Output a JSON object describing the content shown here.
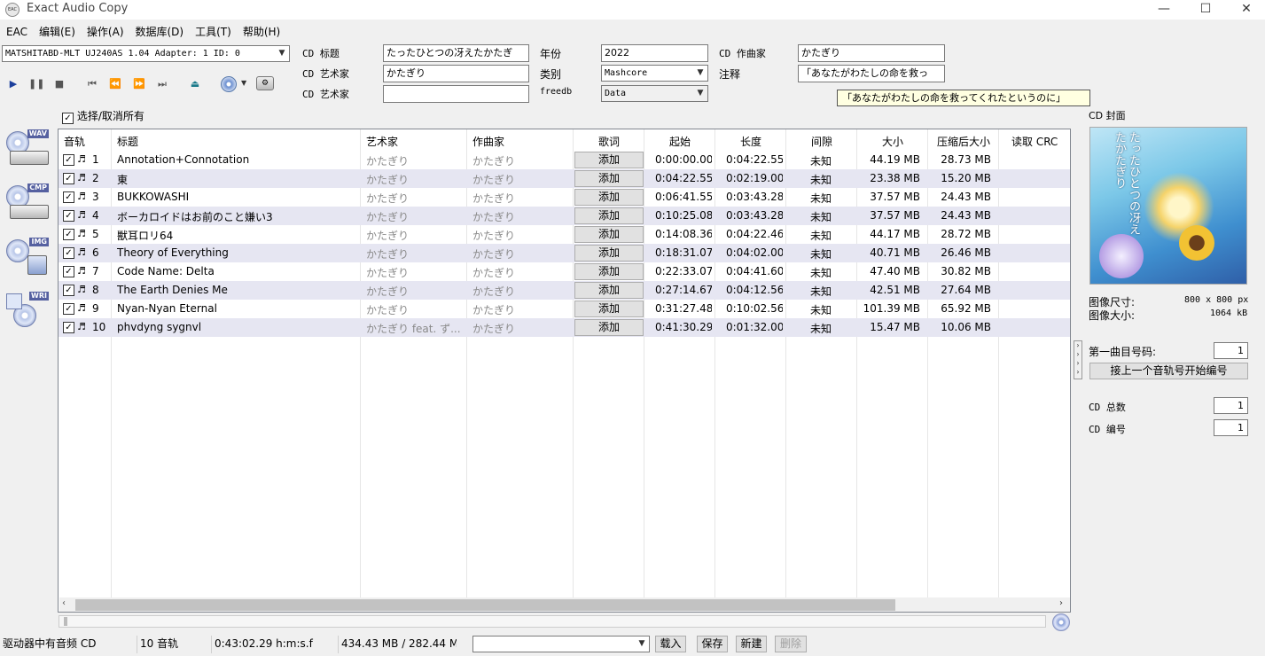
{
  "window": {
    "title": "Exact Audio Copy",
    "icon_text": "EAC",
    "minimize_glyph": "—",
    "maximize_glyph": "☐",
    "close_glyph": "✕"
  },
  "menu": [
    "EAC",
    "编辑(E)",
    "操作(A)",
    "数据库(D)",
    "工具(T)",
    "帮助(H)"
  ],
  "drive": {
    "selected": "MATSHITABD-MLT UJ240AS 1.04   Adapter: 1  ID: 0"
  },
  "metadata": {
    "cd_title_label": "CD 标题",
    "cd_title": "たったひとつの冴えたかたぎ",
    "cd_artist_label": "CD 艺术家",
    "cd_artist": "かたぎり",
    "cd_artist2_label": "CD 艺术家",
    "cd_artist2": "",
    "year_label": "年份",
    "year": "2022",
    "genre_label": "类别",
    "genre": "Mashcore",
    "freedb_label": "freedb",
    "freedb": "Data",
    "composer_label": "CD 作曲家",
    "composer": "かたぎり",
    "comment_label": "注释",
    "comment": "「あなたがわたしの命を救っ",
    "tooltip": "「あなたがわたしの命を救ってくれたというのに」"
  },
  "select_all_label": "选择/取消所有",
  "side_icons": [
    {
      "name": "wav-icon",
      "tag": "WAV"
    },
    {
      "name": "cmp-icon",
      "tag": "CMP"
    },
    {
      "name": "img-icon",
      "tag": "IMG"
    },
    {
      "name": "wri-icon",
      "tag": "WRI"
    }
  ],
  "table": {
    "headers": {
      "track": "音轨",
      "title": "标题",
      "artist": "艺术家",
      "composer": "作曲家",
      "lyrics": "歌词",
      "start": "起始",
      "length": "长度",
      "gap": "间隙",
      "size": "大小",
      "compressed": "压缩后大小",
      "crc": "读取 CRC"
    },
    "rows": [
      {
        "num": "1",
        "title": "Annotation+Connotation",
        "artist": "かたぎり",
        "composer": "かたぎり",
        "lyrics": "添加",
        "start": "0:00:00.00",
        "length": "0:04:22.55",
        "gap": "未知",
        "size": "44.19 MB",
        "compressed": "28.73 MB",
        "crc": ""
      },
      {
        "num": "2",
        "title": "東",
        "artist": "かたぎり",
        "composer": "かたぎり",
        "lyrics": "添加",
        "start": "0:04:22.55",
        "length": "0:02:19.00",
        "gap": "未知",
        "size": "23.38 MB",
        "compressed": "15.20 MB",
        "crc": ""
      },
      {
        "num": "3",
        "title": "BUKKOWASHI",
        "artist": "かたぎり",
        "composer": "かたぎり",
        "lyrics": "添加",
        "start": "0:06:41.55",
        "length": "0:03:43.28",
        "gap": "未知",
        "size": "37.57 MB",
        "compressed": "24.43 MB",
        "crc": ""
      },
      {
        "num": "4",
        "title": "ボーカロイドはお前のこと嫌い3",
        "artist": "かたぎり",
        "composer": "かたぎり",
        "lyrics": "添加",
        "start": "0:10:25.08",
        "length": "0:03:43.28",
        "gap": "未知",
        "size": "37.57 MB",
        "compressed": "24.43 MB",
        "crc": ""
      },
      {
        "num": "5",
        "title": "獣耳ロリ64",
        "artist": "かたぎり",
        "composer": "かたぎり",
        "lyrics": "添加",
        "start": "0:14:08.36",
        "length": "0:04:22.46",
        "gap": "未知",
        "size": "44.17 MB",
        "compressed": "28.72 MB",
        "crc": ""
      },
      {
        "num": "6",
        "title": "Theory of Everything",
        "artist": "かたぎり",
        "composer": "かたぎり",
        "lyrics": "添加",
        "start": "0:18:31.07",
        "length": "0:04:02.00",
        "gap": "未知",
        "size": "40.71 MB",
        "compressed": "26.46 MB",
        "crc": ""
      },
      {
        "num": "7",
        "title": "Code Name: Delta",
        "artist": "かたぎり",
        "composer": "かたぎり",
        "lyrics": "添加",
        "start": "0:22:33.07",
        "length": "0:04:41.60",
        "gap": "未知",
        "size": "47.40 MB",
        "compressed": "30.82 MB",
        "crc": ""
      },
      {
        "num": "8",
        "title": "The Earth Denies Me",
        "artist": "かたぎり",
        "composer": "かたぎり",
        "lyrics": "添加",
        "start": "0:27:14.67",
        "length": "0:04:12.56",
        "gap": "未知",
        "size": "42.51 MB",
        "compressed": "27.64 MB",
        "crc": ""
      },
      {
        "num": "9",
        "title": "Nyan-Nyan Eternal",
        "artist": "かたぎり",
        "composer": "かたぎり",
        "lyrics": "添加",
        "start": "0:31:27.48",
        "length": "0:10:02.56",
        "gap": "未知",
        "size": "101.39 MB",
        "compressed": "65.92 MB",
        "crc": ""
      },
      {
        "num": "10",
        "title": "phvdyng sygnvl",
        "artist": "かたぎり feat. ず...",
        "composer": "かたぎり",
        "lyrics": "添加",
        "start": "0:41:30.29",
        "length": "0:01:32.00",
        "gap": "未知",
        "size": "15.47 MB",
        "compressed": "10.06 MB",
        "crc": ""
      }
    ]
  },
  "cover": {
    "label": "CD 封面",
    "art_text": "たったひとつの冴えたかたぎり",
    "dims_label": "图像尺寸:",
    "dims_value": "800 x 800 px",
    "size_label": "图像大小:",
    "size_value": "1064 kB"
  },
  "numbering": {
    "first_track_label": "第一曲目号码:",
    "first_track_value": "1",
    "continue_button": "接上一个音轨号开始编号",
    "total_cds_label": "CD 总数",
    "total_cds_value": "1",
    "cd_number_label": "CD 编号",
    "cd_number_value": "1"
  },
  "status": {
    "drive_status": "驱动器中有音频 CD",
    "track_count": "10 音轨",
    "total_time": "0:43:02.29 h:m:s.f",
    "total_size": "434.43 MB / 282.44 M",
    "profile": "",
    "load_button": "载入",
    "save_button": "保存",
    "new_button": "新建",
    "delete_button": "删除"
  },
  "colors": {
    "selection_row": "#e6e6f2",
    "play_blue": "#1c3f9c",
    "eject_teal": "#1a7a8a"
  }
}
